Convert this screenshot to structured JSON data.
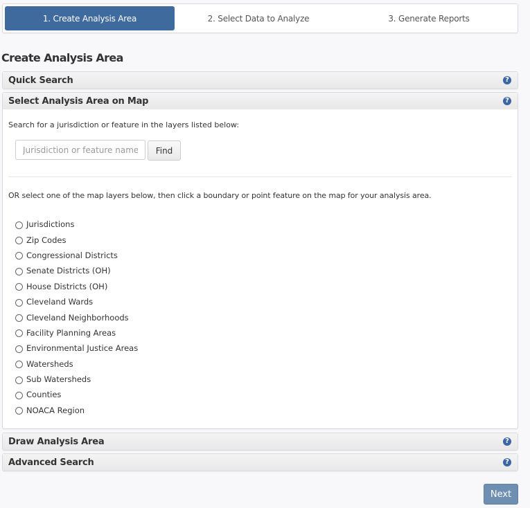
{
  "wizard": {
    "steps": [
      {
        "label": "1. Create Analysis Area",
        "active": true
      },
      {
        "label": "2. Select Data to Analyze",
        "active": false
      },
      {
        "label": "3. Generate Reports",
        "active": false
      }
    ]
  },
  "page_title": "Create Analysis Area",
  "panels": {
    "quick_search": {
      "title": "Quick Search",
      "help_icon": "question-circle-icon"
    },
    "select_on_map": {
      "title": "Select Analysis Area on Map",
      "help_icon": "question-circle-icon",
      "intro_text": "Search for a jurisdiction or feature in the layers listed below:",
      "search_placeholder": "Jurisdiction or feature name",
      "search_value": "",
      "find_label": "Find",
      "or_text": "OR select one of the map layers below, then click a boundary or point feature on the map for your analysis area.",
      "layers": [
        "Jurisdictions",
        "Zip Codes",
        "Congressional Districts",
        "Senate Districts (OH)",
        "House Districts (OH)",
        "Cleveland Wards",
        "Cleveland Neighborhoods",
        "Facility Planning Areas",
        "Environmental Justice Areas",
        "Watersheds",
        "Sub Watersheds",
        "Counties",
        "NOACA Region"
      ]
    },
    "draw_area": {
      "title": "Draw Analysis Area",
      "help_icon": "question-circle-icon"
    },
    "advanced_search": {
      "title": "Advanced Search",
      "help_icon": "question-circle-icon"
    }
  },
  "next_label": "Next",
  "colors": {
    "accent": "#3f6a9d",
    "help_icon": "#3b66a3",
    "next_button": "#6e8fb1"
  }
}
